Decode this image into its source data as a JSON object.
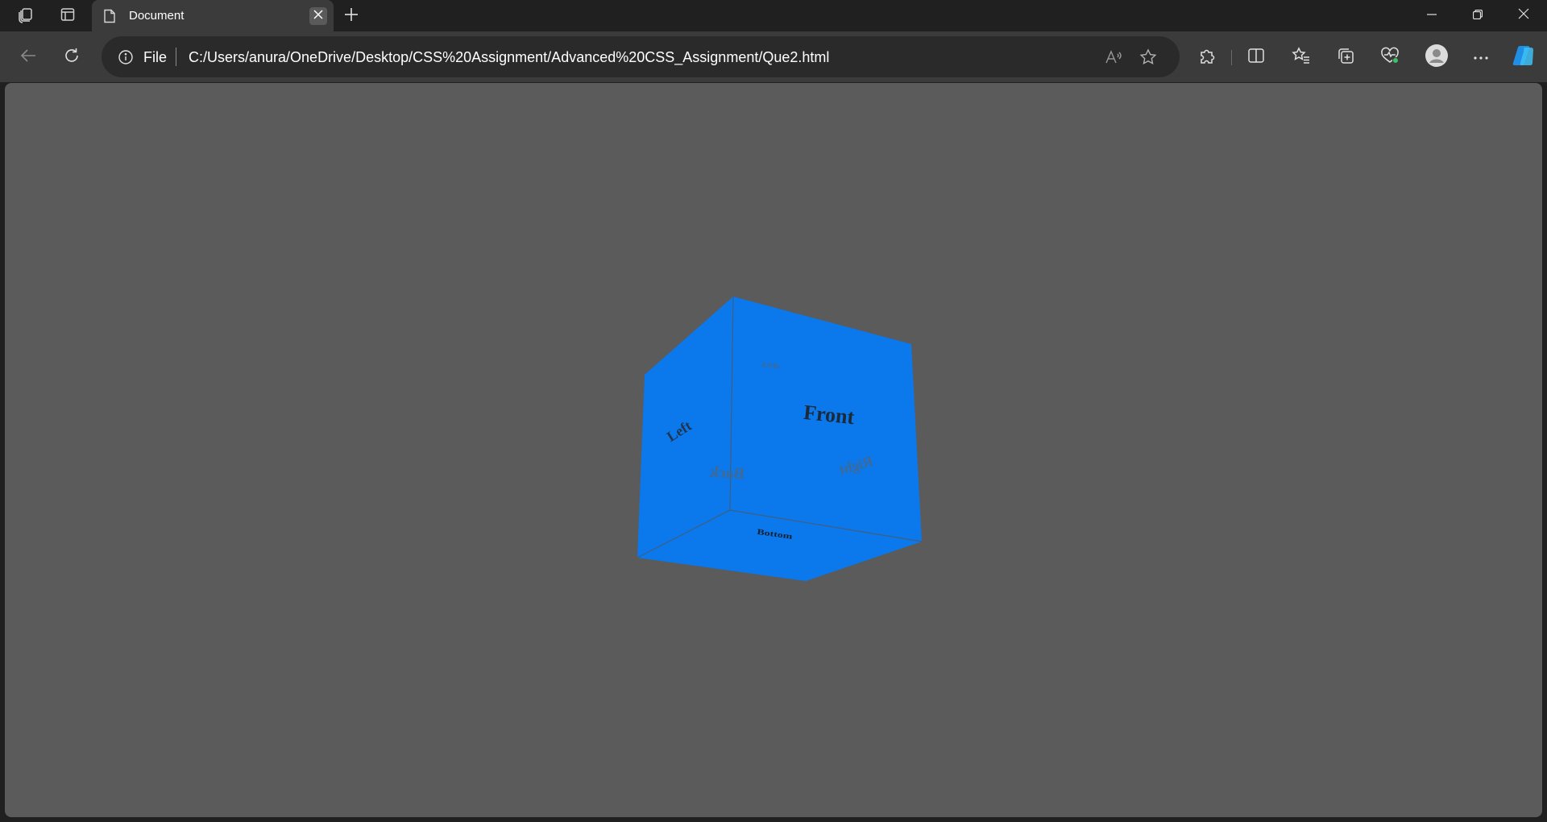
{
  "tab": {
    "title": "Document"
  },
  "address_bar": {
    "scheme_label": "File",
    "url": "C:/Users/anura/OneDrive/Desktop/CSS%20Assignment/Advanced%20CSS_Assignment/Que2.html"
  },
  "icons": {
    "workspaces": "workspaces-icon",
    "tab_actions": "tab-actions-icon",
    "page": "page-icon",
    "close_tab": "close-icon",
    "new_tab": "plus-icon",
    "minimize": "minimize-icon",
    "restore": "restore-icon",
    "close_window": "close-icon",
    "back": "back-arrow-icon",
    "refresh": "refresh-icon",
    "info": "info-icon",
    "read_aloud": "read-aloud-icon",
    "favorite": "star-icon",
    "extensions": "puzzle-icon",
    "split_screen": "split-screen-icon",
    "favorites": "favorites-icon",
    "collections": "collections-icon",
    "browser_essentials": "heart-pulse-icon",
    "profile": "avatar-icon",
    "more": "more-icon",
    "copilot": "copilot-icon"
  },
  "page": {
    "background": "#5b5b5b",
    "cube": {
      "color": "#0b78ec",
      "faces": {
        "front": "Front",
        "back": "Back",
        "left": "Left",
        "right": "Right",
        "top": "Top",
        "bottom": "Bottom"
      }
    }
  }
}
